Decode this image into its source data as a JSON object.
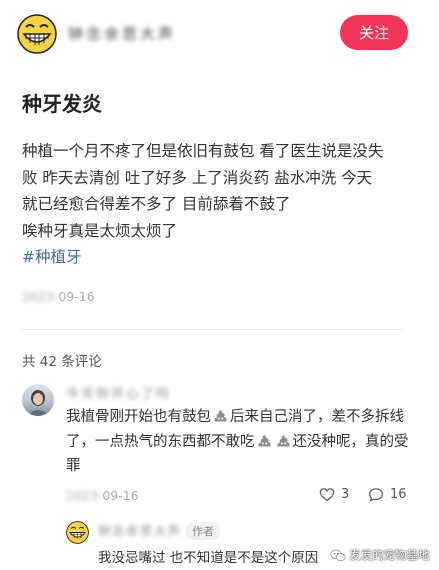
{
  "header": {
    "author_name": "钟念余思大声",
    "follow_label": "关注"
  },
  "post": {
    "title": "种牙发炎",
    "lines": [
      "种植一个月不疼了但是依旧有鼓包 看了医生说是没失",
      "败 昨天去清创 吐了好多 上了消炎药 盐水冲洗 今天",
      "就已经愈合得差不多了 目前舔着不鼓了",
      "唉种牙真是太烦太烦了"
    ],
    "hashtag": "#种植牙",
    "date_hidden": "2023-",
    "date_visible": "09-16"
  },
  "comments": {
    "count_label": "共 42 条评论",
    "items": [
      {
        "author": "今天你开心了吗",
        "text_line1_a": "我植骨刚开始也有鼓包",
        "text_line1_b": "后来自己消了，差不多拆线",
        "text_line2_a": "了，一点热气的东西都不敢吃",
        "text_line2_b": "还没种呢，真的受",
        "text_line3": "罪",
        "date_hidden": "2023-",
        "date_visible": "09-16",
        "likes": "3",
        "replies": "16",
        "reply": {
          "author": "钟念余思大声",
          "tag": "作者",
          "text": "我没忌嘴过 也不知道是不是这个原因"
        }
      }
    ]
  },
  "watermark": {
    "text": "发发的宠物基地"
  },
  "colors": {
    "accent": "#f43558",
    "hashtag": "#3e6da2"
  },
  "icons": [
    "grinning-face-icon",
    "poop-emoji-icon",
    "heart-icon",
    "comment-bubble-icon",
    "wechat-icon"
  ]
}
